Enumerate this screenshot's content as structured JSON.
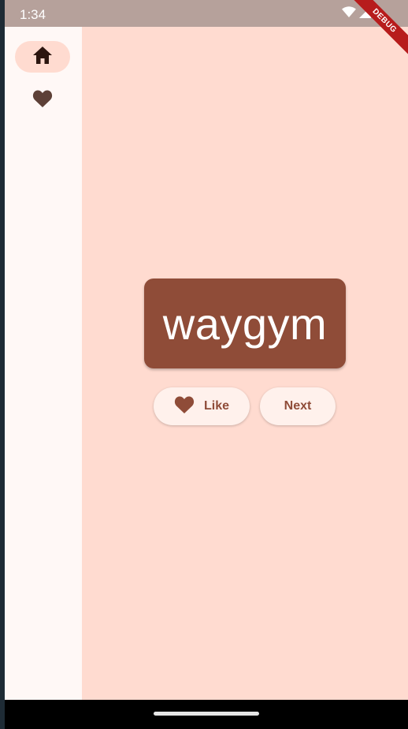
{
  "status_bar": {
    "time": "1:34",
    "icons": [
      "wifi-icon",
      "signal-icon",
      "battery-icon"
    ]
  },
  "debug_banner": {
    "label": "DEBUG"
  },
  "navigation_rail": {
    "items": [
      {
        "icon": "home-icon",
        "selected": true
      },
      {
        "icon": "favorite-icon",
        "selected": false
      }
    ]
  },
  "main": {
    "word": "waygym",
    "like_button_label": "Like",
    "next_button_label": "Next"
  },
  "colors": {
    "background": "#ffdbd0",
    "rail_background": "#fff8f6",
    "primary": "#8f4c38",
    "button_background": "#fff1ec"
  }
}
